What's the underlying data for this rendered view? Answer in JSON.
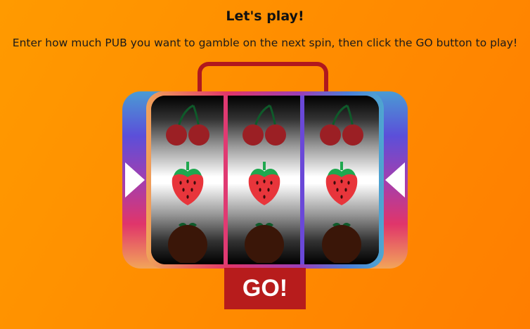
{
  "header": {
    "title": "Let's play!",
    "instructions": "Enter how much PUB you want to gamble on the next spin, then click the GO button to play!"
  },
  "slot_machine": {
    "reels": [
      {
        "symbols": [
          "cherry-icon",
          "strawberry-icon",
          "coconut-icon"
        ]
      },
      {
        "symbols": [
          "cherry-icon",
          "strawberry-icon",
          "coconut-icon"
        ]
      },
      {
        "symbols": [
          "cherry-icon",
          "strawberry-icon",
          "coconut-icon"
        ]
      }
    ],
    "go_label": "GO!"
  },
  "colors": {
    "background": "#ff8c00",
    "handle": "#b0181e",
    "go_button": "#b71c1c",
    "strawberry": "#e8353b",
    "leaf": "#1fa84f",
    "cherry": "#9b1f24"
  }
}
